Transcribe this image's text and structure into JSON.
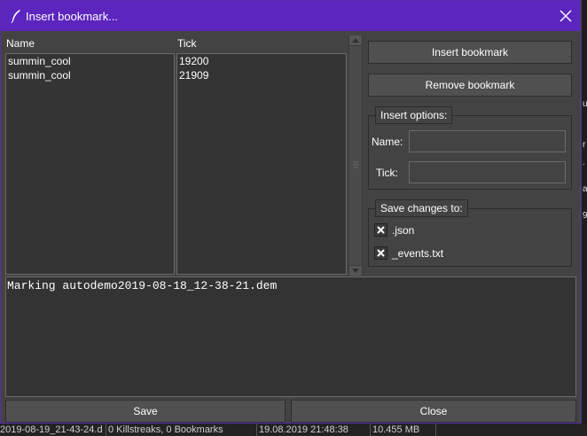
{
  "window": {
    "title": "Insert bookmark...",
    "accent_color": "#5b25be",
    "close_icon": "close-icon"
  },
  "list": {
    "columns": [
      "Name",
      "Tick"
    ],
    "rows": [
      {
        "name": "summin_cool",
        "tick": "19200"
      },
      {
        "name": "summin_cool",
        "tick": "21909"
      }
    ]
  },
  "buttons": {
    "insert": "Insert bookmark",
    "remove": "Remove bookmark",
    "save": "Save",
    "close": "Close"
  },
  "insert_options": {
    "label": "Insert options:",
    "name_label": "Name:",
    "name_value": "",
    "tick_label": "Tick:",
    "tick_value": ""
  },
  "save_changes": {
    "label": "Save changes to:",
    "options": [
      {
        "label": ".json",
        "checked": true
      },
      {
        "label": "_events.txt",
        "checked": true
      }
    ]
  },
  "log": {
    "text": "Marking autodemo2019-08-18_12-38-21.dem"
  },
  "background": {
    "cells": [
      "2019-08-19_21-43-24.d",
      "0 Killstreaks, 0 Bookmarks",
      "19.08.2019  21:48:38",
      "10.455 MB"
    ],
    "side_chars": [
      "u",
      "r",
      ".",
      "a",
      "9"
    ]
  }
}
